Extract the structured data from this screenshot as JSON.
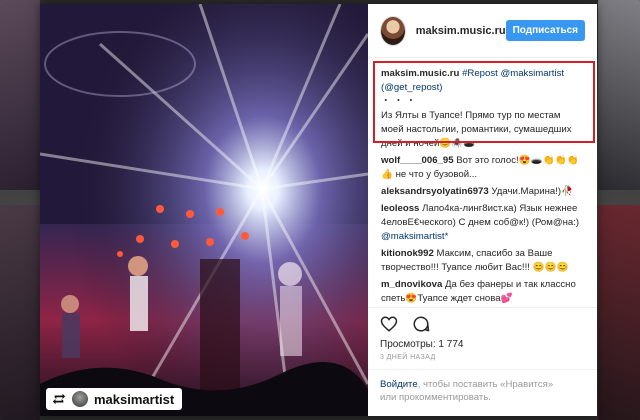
{
  "post": {
    "username": "maksim.music.ru",
    "follow_label": "Подписаться",
    "repost_username": "maksimartist"
  },
  "caption": {
    "username": "maksim.music.ru",
    "text_prefix": "#Repost @maksimartist",
    "text_mention": "(@get_repost)",
    "dots": "・・・",
    "body": "Из Ялты в Туапсе! Прямо тур по местам моей настольгии, романтики, сумашедших дней и ночей😊🕷️🕳️"
  },
  "comments": [
    {
      "username": "wolf____006_95",
      "text": "Вот это голос!😍🕳️👏👏👏👍 не что у бузовой..."
    },
    {
      "username": "aleksandrsyolyatin6973",
      "text": "Удачи.Марина!)🥀"
    },
    {
      "username": "leoleoss",
      "text": "Лапо4ка-линг8ист.ка) Язык нежнее 4еловE€ческого) С днем соб@к!) (Ром@на:)",
      "mention": "@maksimartist*"
    },
    {
      "username": "kitionok992",
      "text": "Максим, спасибо за Ваше творчество!!! Туапсе любит Вас!!! 😊😊😊"
    },
    {
      "username": "m_dnovikova",
      "text": "Да без фанеры и так классно спеть😍Туапсе ждет снова💕"
    }
  ],
  "stats": {
    "views_label": "Просмотры:",
    "views_value": "1 774",
    "time": "3 ДНЕЙ НАЗАД"
  },
  "login_prompt": {
    "link1": "Войдите",
    "text1": ", чтобы поставить «Нравится»",
    "text2": "или прокомментировать."
  },
  "colors": {
    "accent": "#3897f0",
    "highlight": "#d31f28",
    "link": "#003569"
  },
  "icons": [
    "repost-icon",
    "heart-icon",
    "comment-icon"
  ]
}
